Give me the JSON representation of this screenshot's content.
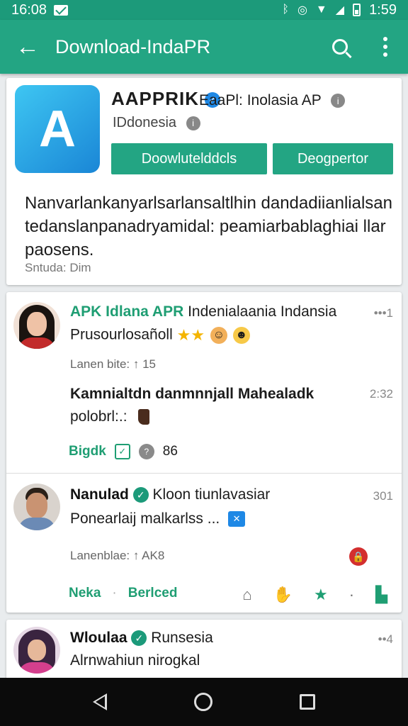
{
  "status_bar": {
    "time_left": "16:08",
    "time_right": "1:59"
  },
  "appbar": {
    "title": "Download-IndaPR"
  },
  "app_card": {
    "icon_letter": "A",
    "app_name": "AAPPRIK",
    "developer": "EaaPl: Inolasia AP",
    "country": "IDdonesia",
    "button_primary": "Doowlutelddcls",
    "button_secondary": "Deogpertor",
    "description": "Nanvarlankanyarlsarlansaltlhin dandadiianlialsan tedanslanpanadryamidal: peamiarbablaghiai llar paosens.",
    "footer": "Sntuda: Dim"
  },
  "posts": [
    {
      "title_green": "APK Idlana APR",
      "title_rest": "Indenialaania Indansia",
      "time": "•••1",
      "line1": "Prusourlosañoll",
      "meta": "Lanen bite: ↑ 15",
      "body_bold": "Kamnialtdn danmnnjall Mahealadk",
      "time2": "2:32",
      "body_line2": "polobrl:.:",
      "action_label": "Bigdk",
      "action_count": "86"
    },
    {
      "name": "Nanulad",
      "title_rest": "Kloon tiunlavasiar",
      "time": "301",
      "line1": "Ponearlaij malkarlss ...",
      "badge": "✕",
      "meta": "Lanenblae: ↑ AK8",
      "action1": "Neka",
      "action2": "Berlced"
    },
    {
      "name": "Wloulaa",
      "title_rest": "Runsesia",
      "time": "••4",
      "line1": "Alrnwahiun nirogkal"
    }
  ]
}
